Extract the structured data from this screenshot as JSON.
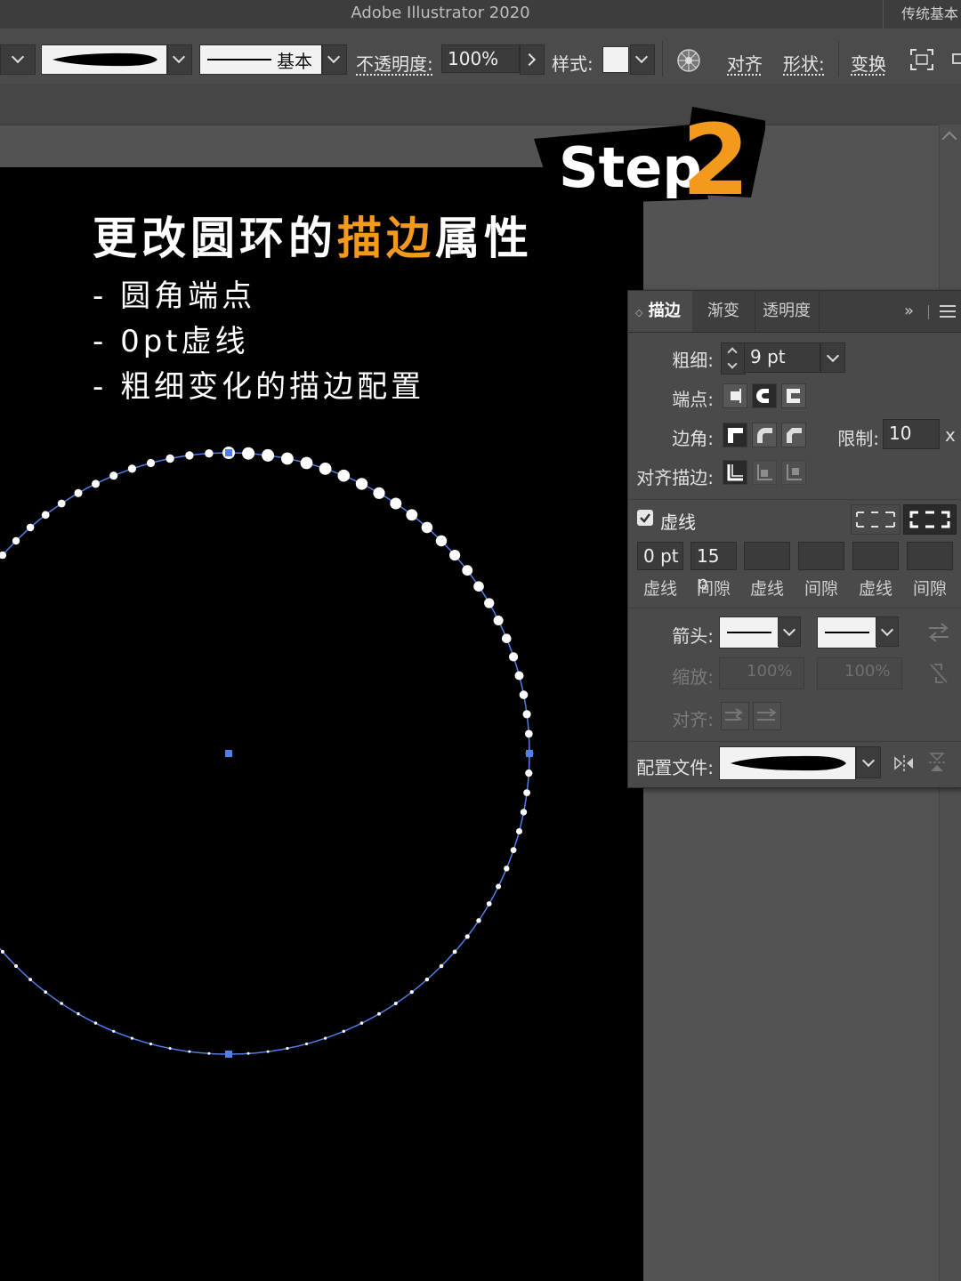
{
  "titlebar": {
    "app_title": "Adobe Illustrator 2020",
    "workspace": "传统基本"
  },
  "controlbar": {
    "stroke_style_label": "基本",
    "opacity_label": "不透明度:",
    "opacity_value": "100%",
    "style_label": "样式:",
    "align_label": "对齐",
    "shape_label": "形状:",
    "transform_label": "变换"
  },
  "overlay": {
    "step_word": "Step",
    "step_num": "2",
    "headline_pre": "更改圆环的",
    "headline_highlight": "描边",
    "headline_post": "属性",
    "bullets": [
      "- 圆角端点",
      "- 0pt虚线",
      "- 粗细变化的描边配置"
    ],
    "highlight_color": "#f39a1d"
  },
  "stroke_panel": {
    "tabs": [
      {
        "label": "描边"
      },
      {
        "label": "渐变"
      },
      {
        "label": "透明度"
      }
    ],
    "weight_label": "粗细:",
    "weight_value": "9 pt",
    "cap_label": "端点:",
    "corner_label": "边角:",
    "limit_label": "限制:",
    "limit_value": "10",
    "limit_unit": "x",
    "align_stroke_label": "对齐描边:",
    "dashed_label": "虚线",
    "dashed_checked": true,
    "dash_values": [
      "0 pt",
      "15 p",
      "",
      "",
      "",
      ""
    ],
    "dash_labels": [
      "虚线",
      "间隙",
      "虚线",
      "间隙",
      "虚线",
      "间隙"
    ],
    "arrow_label": "箭头:",
    "scale_label": "缩放:",
    "scale_start": "100%",
    "scale_end": "100%",
    "arrow_align_label": "对齐:",
    "profile_label": "配置文件:"
  },
  "canvas": {
    "path_color": "#4f7fe8",
    "dot_color": "#ffffff"
  }
}
